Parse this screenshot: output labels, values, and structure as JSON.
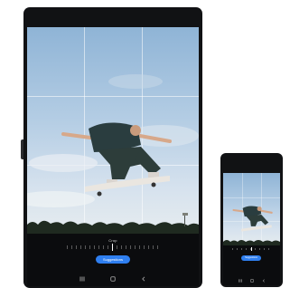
{
  "tablet": {
    "mode_label": "Crop",
    "action_button": "Suggestions",
    "nav": [
      "recents-icon",
      "home-icon",
      "back-icon"
    ]
  },
  "phone": {
    "action_button": "Suggestions",
    "nav": [
      "recents-icon",
      "home-icon",
      "back-icon"
    ]
  },
  "colors": {
    "accent": "#2f7ff0",
    "device_frame": "#111214",
    "sky_top": "#8fb4d6",
    "sky_bottom": "#e6ecef"
  }
}
